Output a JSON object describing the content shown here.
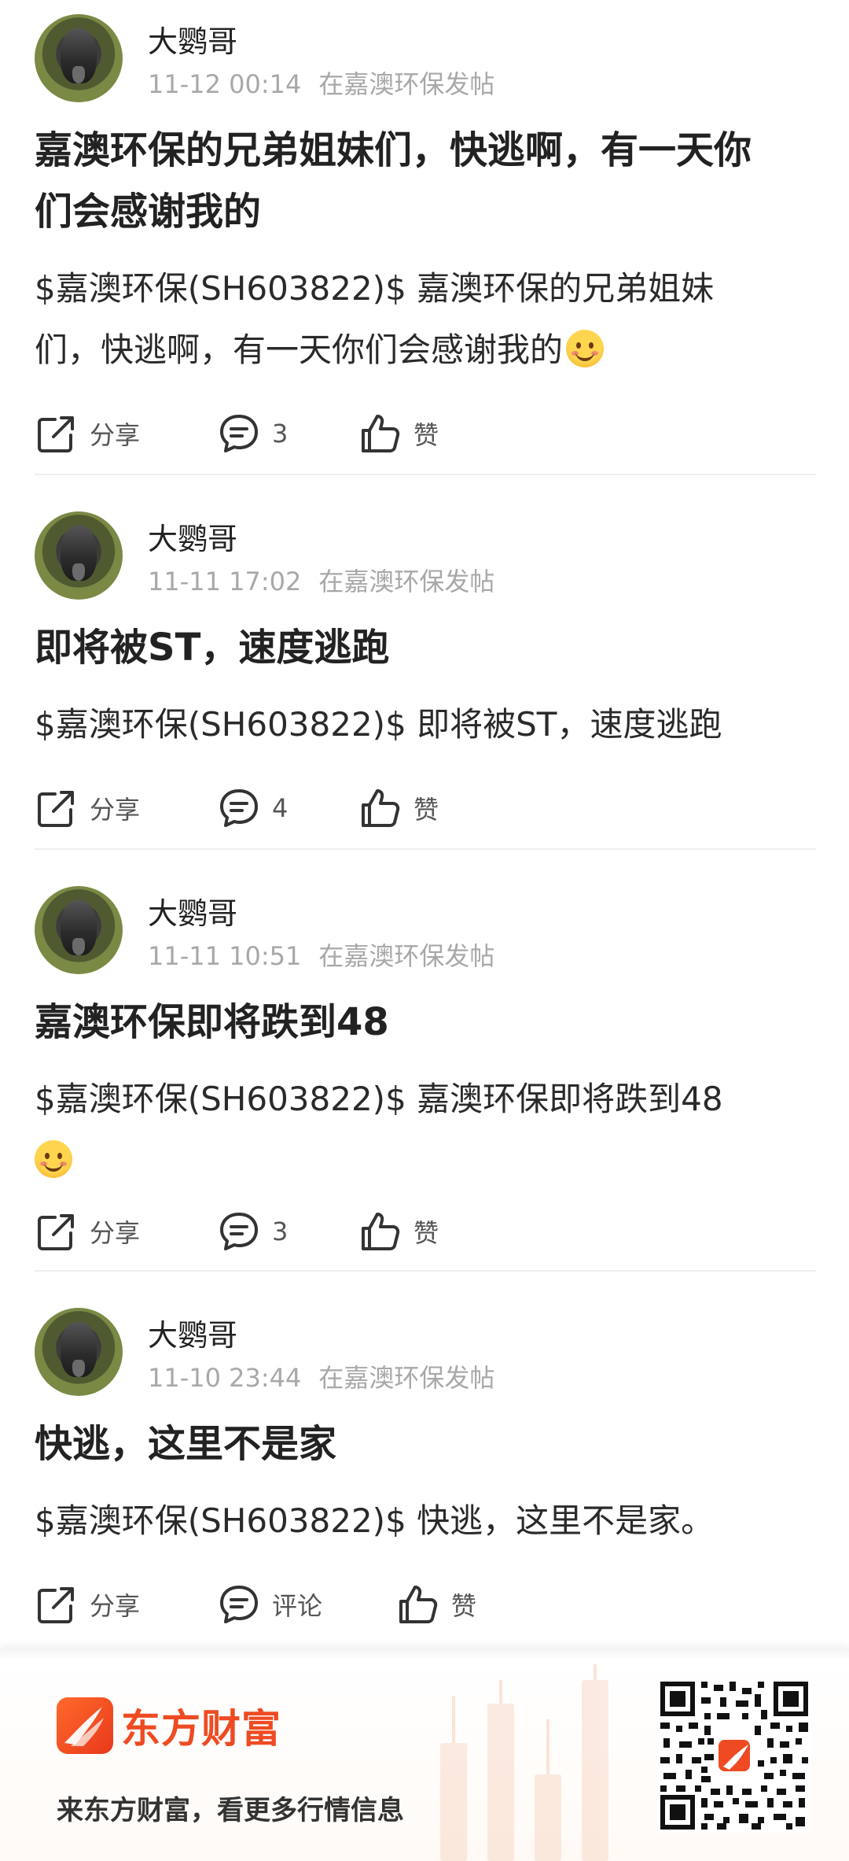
{
  "posts": [
    {
      "author": "大鹦哥",
      "time": "11-12 00:14",
      "location": "在嘉澳环保发帖",
      "title_lines": [
        "嘉澳环保的兄弟姐妹们，快逃啊，有一天你",
        "们会感谢我的"
      ],
      "body_lines": [
        "$嘉澳环保(SH603822)$ 嘉澳环保的兄弟姐妹",
        "们，快逃啊，有一天你们会感谢我的"
      ],
      "emoji": "smile-emoji",
      "share_label": "分享",
      "comment_label": "3",
      "like_label": "赞"
    },
    {
      "author": "大鹦哥",
      "time": "11-11 17:02",
      "location": "在嘉澳环保发帖",
      "title_lines": [
        "即将被ST，速度逃跑"
      ],
      "body_lines": [
        "$嘉澳环保(SH603822)$ 即将被ST，速度逃跑"
      ],
      "share_label": "分享",
      "comment_label": "4",
      "like_label": "赞"
    },
    {
      "author": "大鹦哥",
      "time": "11-11 10:51",
      "location": "在嘉澳环保发帖",
      "title_lines": [
        "嘉澳环保即将跌到48"
      ],
      "body_lines": [
        "$嘉澳环保(SH603822)$ 嘉澳环保即将跌到48",
        ""
      ],
      "emoji": "smile-emoji",
      "share_label": "分享",
      "comment_label": "3",
      "like_label": "赞"
    },
    {
      "author": "大鹦哥",
      "time": "11-10 23:44",
      "location": "在嘉澳环保发帖",
      "title_lines": [
        "快逃，这里不是家"
      ],
      "body_lines": [
        "$嘉澳环保(SH603822)$ 快逃，这里不是家。"
      ],
      "share_label": "分享",
      "comment_label": "评论",
      "like_label": "赞"
    }
  ],
  "footer": {
    "brand": "东方财富",
    "slogan": "来东方财富，看更多行情信息",
    "brand_color": "#ee4b23"
  },
  "icons": {
    "share": "share-icon",
    "comment": "comment-icon",
    "like": "thumbs-up-icon"
  }
}
